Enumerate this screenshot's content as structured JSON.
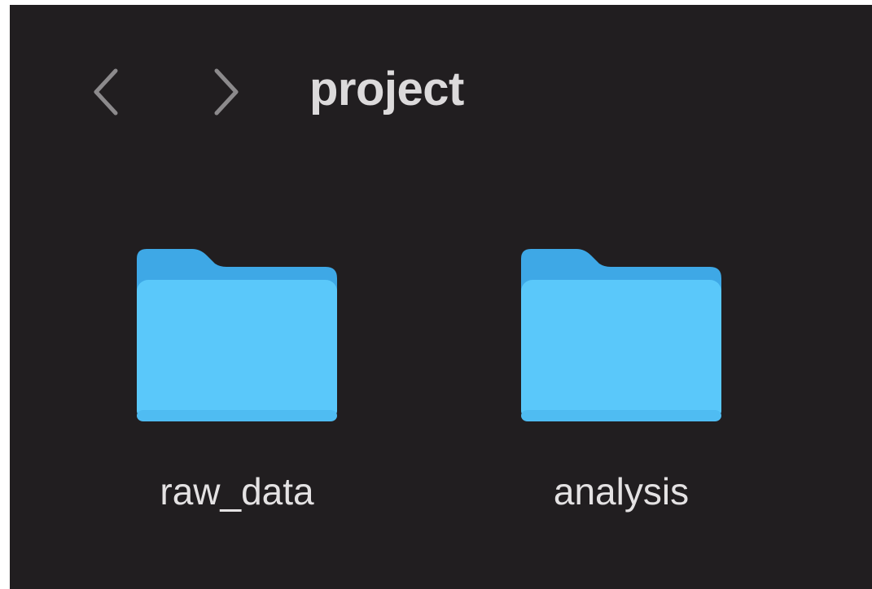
{
  "window": {
    "background": "#211e20"
  },
  "toolbar": {
    "back_icon": "chevron-left-icon",
    "forward_icon": "chevron-right-icon",
    "title": "project"
  },
  "folders": [
    {
      "name": "raw_data",
      "icon": "folder-icon",
      "color": "#5ac8fa"
    },
    {
      "name": "analysis",
      "icon": "folder-icon",
      "color": "#5ac8fa"
    }
  ],
  "colors": {
    "folder_front": "#5ac8fa",
    "folder_back": "#3ea8e6",
    "text": "#e4e2e3",
    "nav_icon": "#8c8a8c"
  }
}
